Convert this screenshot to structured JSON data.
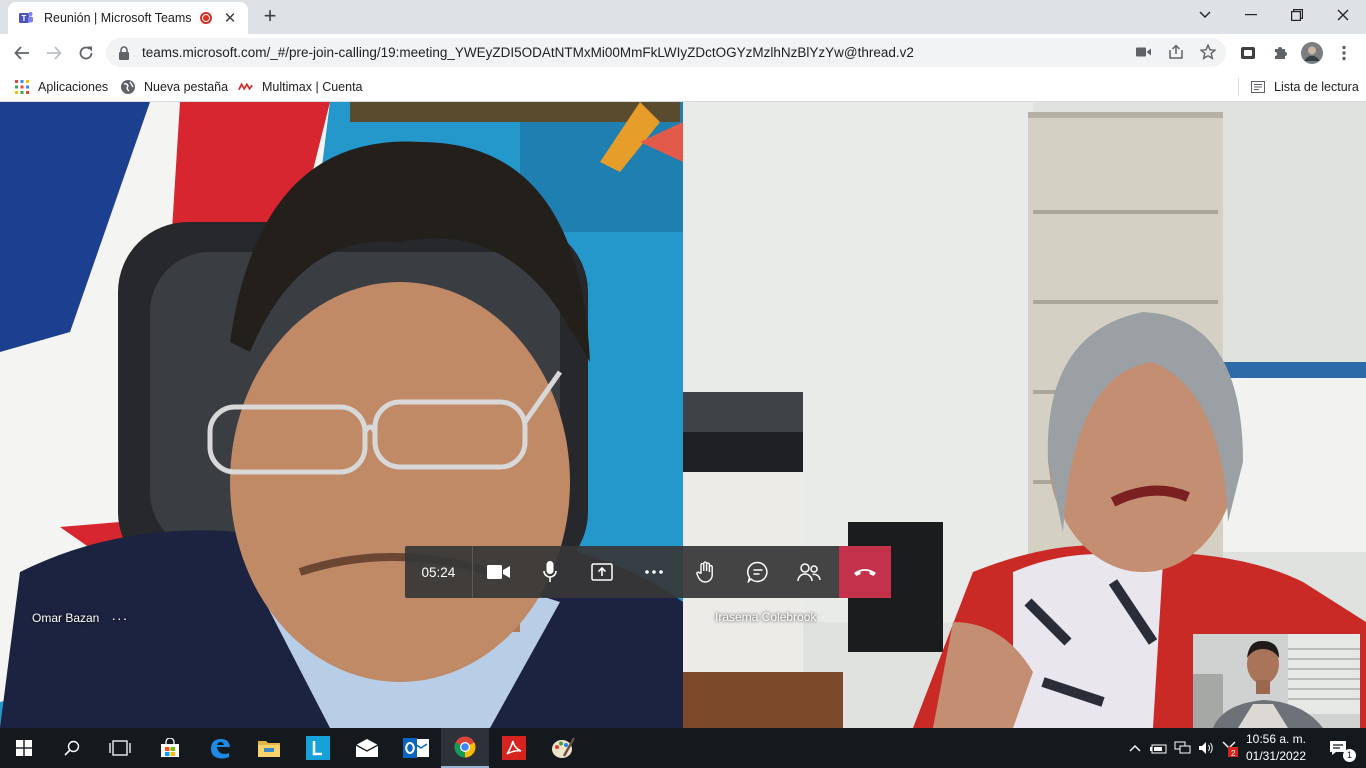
{
  "browser": {
    "tab_title": "Reunión | Microsoft Teams",
    "tab_close": "✕",
    "new_tab": "+",
    "url": "teams.microsoft.com/_#/pre-join-calling/19:meeting_YWEyZDI5ODAtNTMxMi00MmFkLWIyZDctOGYzMzlhNzBlYzYw@thread.v2",
    "window_controls": [
      "chevron-down",
      "minimize",
      "restore",
      "close"
    ]
  },
  "bookmarks": {
    "items": [
      {
        "label": "Aplicaciones",
        "icon": "apps-grid-icon"
      },
      {
        "label": "Nueva pestaña",
        "icon": "globe-icon"
      },
      {
        "label": "Multimax | Cuenta",
        "icon": "multimax-icon"
      }
    ],
    "reading_list": "Lista de lectura"
  },
  "meeting": {
    "participants": [
      {
        "name": "Omar Bazan",
        "more": "···"
      },
      {
        "name": "Irasema Colebrook"
      }
    ],
    "timer": "05:24",
    "controls": [
      "camera-icon",
      "microphone-icon",
      "share-screen-icon",
      "more-options-icon",
      "raise-hand-icon",
      "chat-icon",
      "participants-icon",
      "hang-up-icon"
    ],
    "hangup_color": "#c4314b"
  },
  "taskbar": {
    "apps": [
      "start",
      "search",
      "task-view",
      "store",
      "edge",
      "file-explorer",
      "lync",
      "mail",
      "outlook",
      "chrome",
      "acrobat",
      "paint"
    ],
    "active_app": "chrome",
    "clock_time": "10:56 a. m.",
    "clock_date": "01/31/2022",
    "notification_count": "1",
    "calendar_badge": "2"
  }
}
